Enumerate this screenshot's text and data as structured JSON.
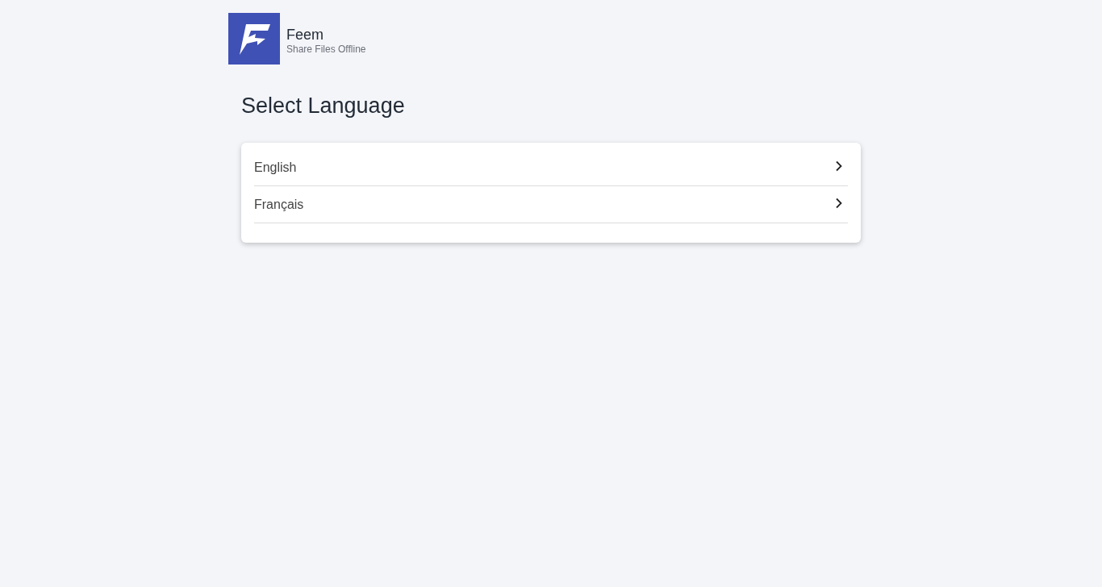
{
  "brand": {
    "name": "Feem",
    "tagline": "Share Files Offline"
  },
  "heading": "Select Language",
  "languages": [
    {
      "label": "English"
    },
    {
      "label": "Français"
    }
  ]
}
